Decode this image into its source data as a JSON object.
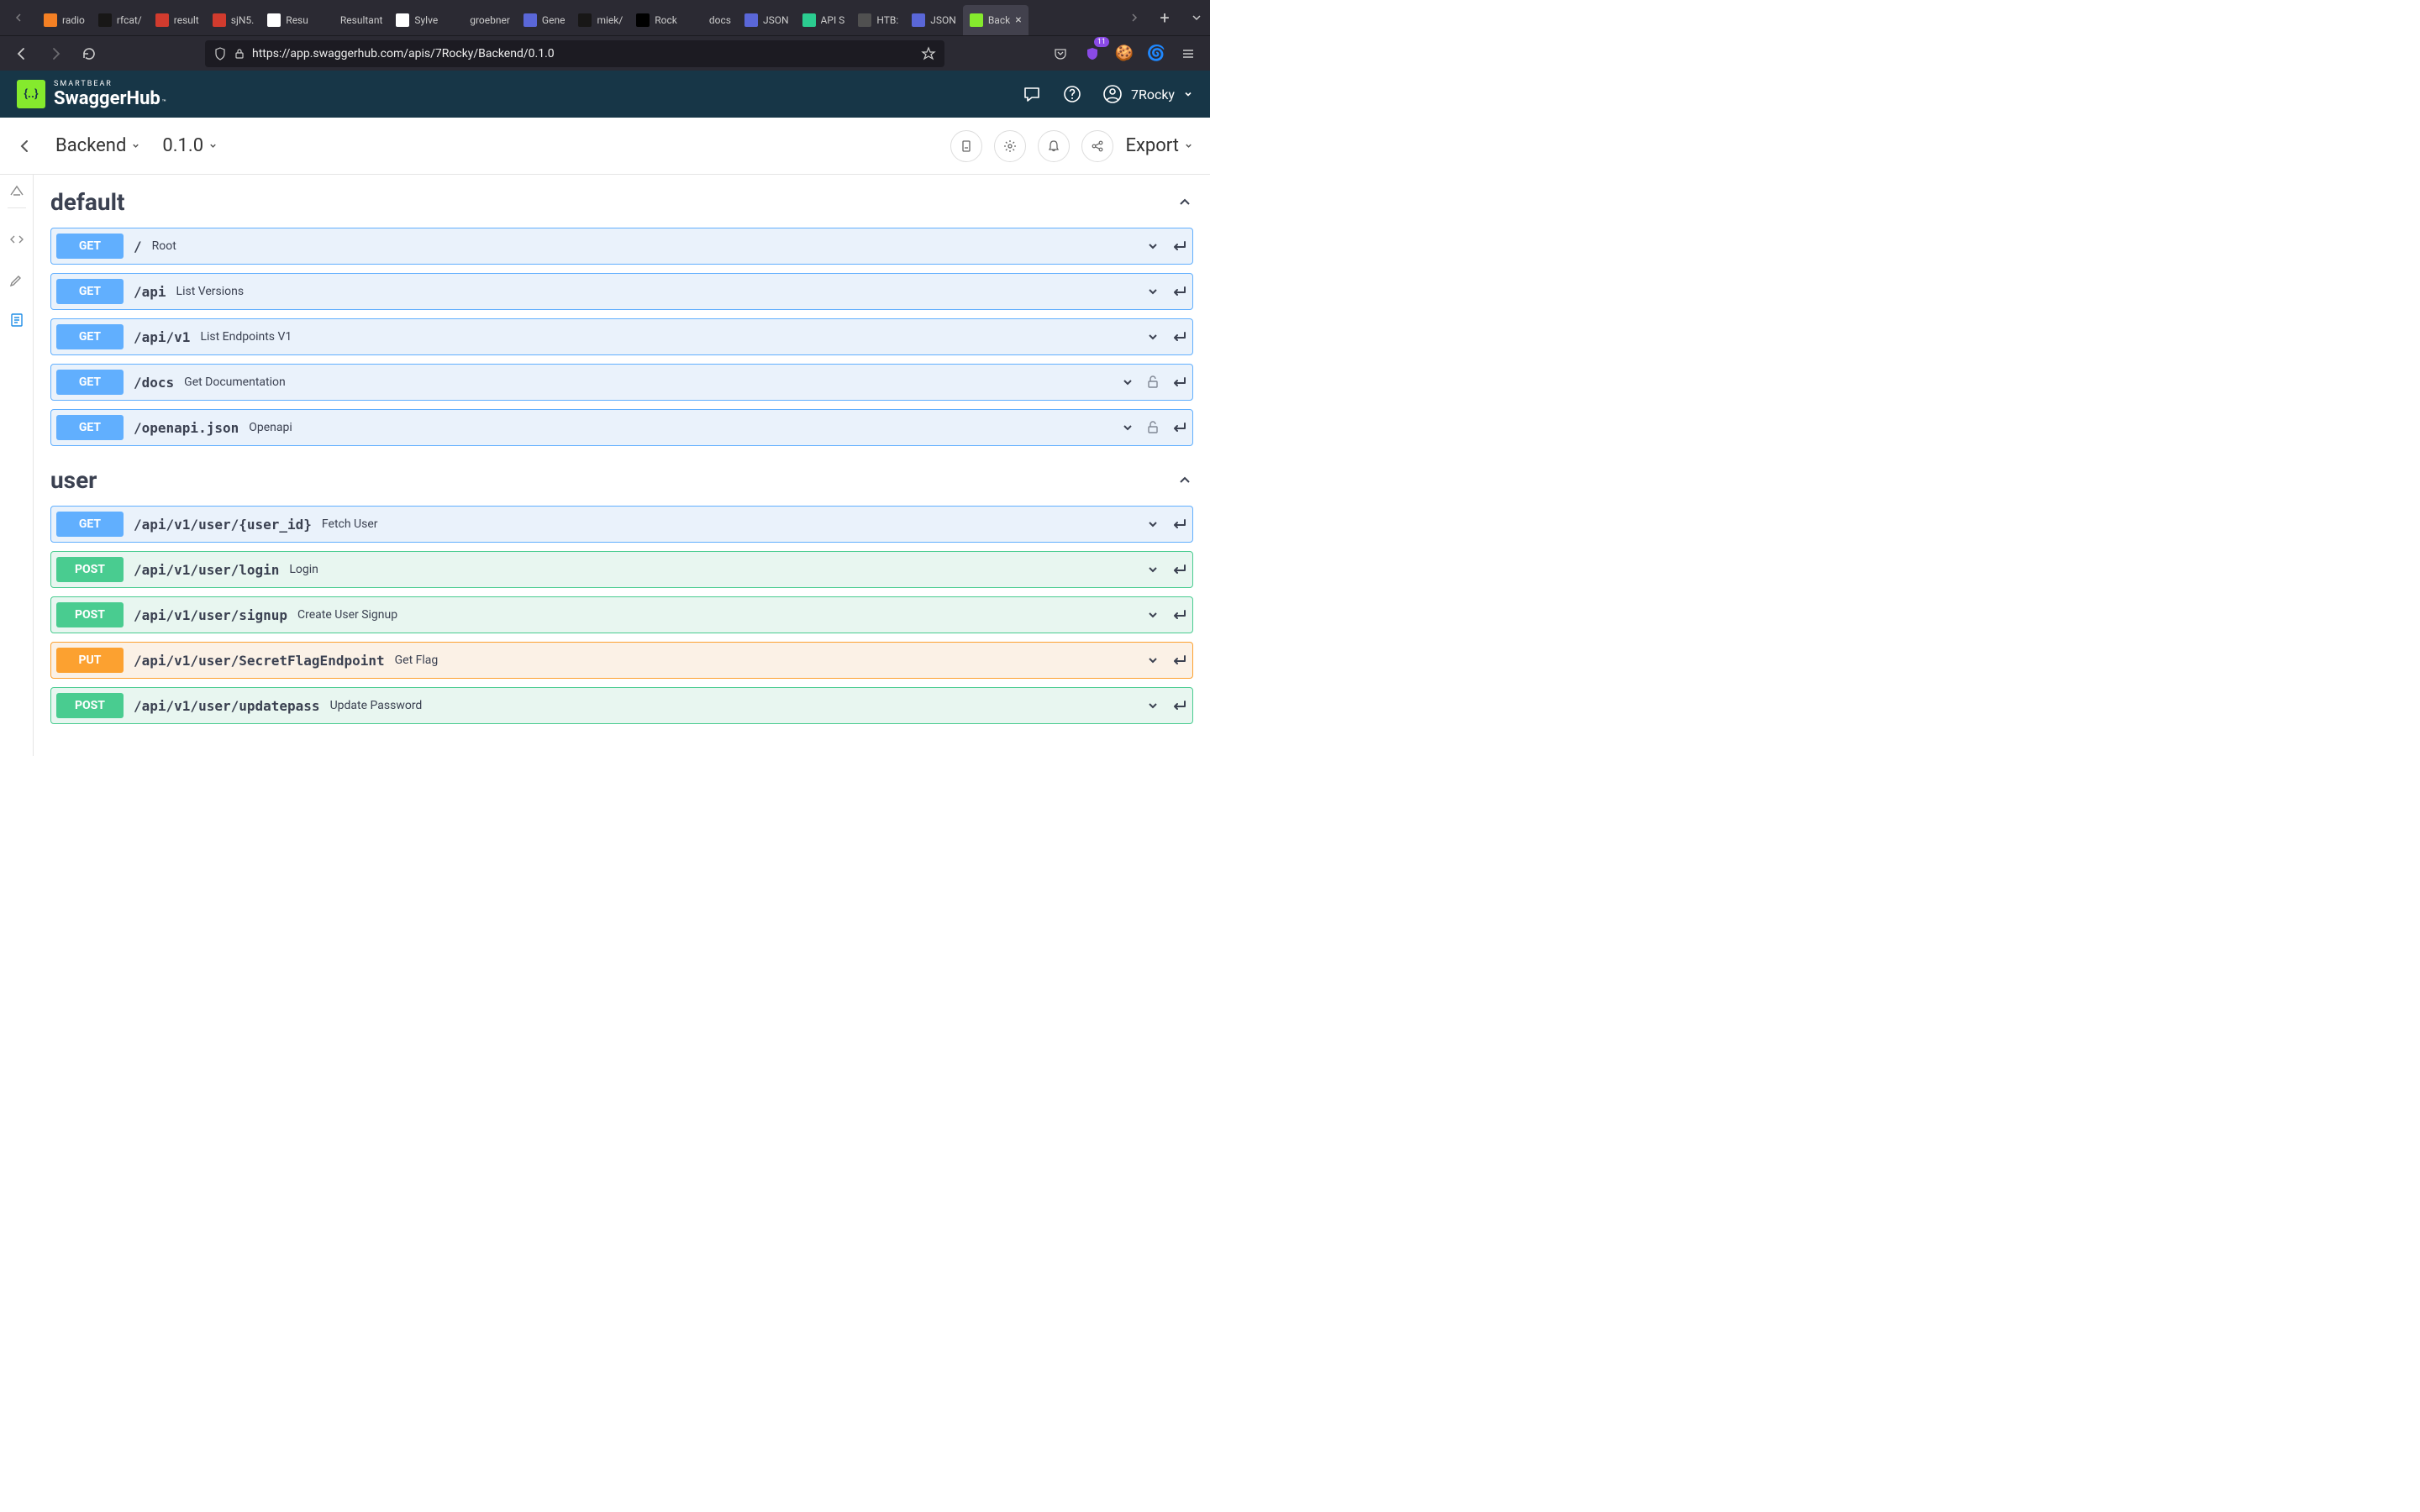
{
  "browser": {
    "tabs": [
      {
        "label": "radio",
        "favicon_bg": "#f48024"
      },
      {
        "label": "rfcat/",
        "favicon_bg": "#181717"
      },
      {
        "label": "result",
        "favicon_bg": "#d13b2e"
      },
      {
        "label": "sjN5.",
        "favicon_bg": "#d13b2e"
      },
      {
        "label": "Resu",
        "favicon_bg": "#ffffff"
      },
      {
        "label": "Resultant",
        "favicon_bg": "transparent"
      },
      {
        "label": "Sylve",
        "favicon_bg": "#ffffff"
      },
      {
        "label": "groebner",
        "favicon_bg": "transparent"
      },
      {
        "label": "Gene",
        "favicon_bg": "#5a67d8"
      },
      {
        "label": "miek/",
        "favicon_bg": "#181717"
      },
      {
        "label": "Rock",
        "favicon_bg": "#000000"
      },
      {
        "label": "docs",
        "favicon_bg": "transparent"
      },
      {
        "label": "JSON",
        "favicon_bg": "#5a67d8"
      },
      {
        "label": "API S",
        "favicon_bg": "#2bcc90"
      },
      {
        "label": "HTB:",
        "favicon_bg": "#505050"
      },
      {
        "label": "JSON",
        "favicon_bg": "#5a67d8"
      },
      {
        "label": "Back",
        "favicon_bg": "#85ea2d",
        "active": true
      }
    ],
    "url": "https://app.swaggerhub.com/apis/7Rocky/Backend/0.1.0",
    "ext_badge": "11"
  },
  "swaggerhub": {
    "brand_small": "SMARTBEAR",
    "brand_big": "SwaggerHub",
    "user": "7Rocky"
  },
  "page": {
    "api_name": "Backend",
    "version": "0.1.0",
    "export_label": "Export"
  },
  "tags": [
    {
      "name": "default",
      "ops": [
        {
          "method": "GET",
          "path": "/",
          "summary": "Root",
          "lock": false
        },
        {
          "method": "GET",
          "path": "/api",
          "summary": "List Versions",
          "lock": false
        },
        {
          "method": "GET",
          "path": "/api/v1",
          "summary": "List Endpoints V1",
          "lock": false
        },
        {
          "method": "GET",
          "path": "/docs",
          "summary": "Get Documentation",
          "lock": true
        },
        {
          "method": "GET",
          "path": "/openapi.json",
          "summary": "Openapi",
          "lock": true
        }
      ]
    },
    {
      "name": "user",
      "ops": [
        {
          "method": "GET",
          "path": "/api/v1/user/{user_id}",
          "summary": "Fetch User",
          "lock": false
        },
        {
          "method": "POST",
          "path": "/api/v1/user/login",
          "summary": "Login",
          "lock": false
        },
        {
          "method": "POST",
          "path": "/api/v1/user/signup",
          "summary": "Create User Signup",
          "lock": false
        },
        {
          "method": "PUT",
          "path": "/api/v1/user/SecretFlagEndpoint",
          "summary": "Get Flag",
          "lock": false
        },
        {
          "method": "POST",
          "path": "/api/v1/user/updatepass",
          "summary": "Update Password",
          "lock": false
        }
      ]
    }
  ]
}
